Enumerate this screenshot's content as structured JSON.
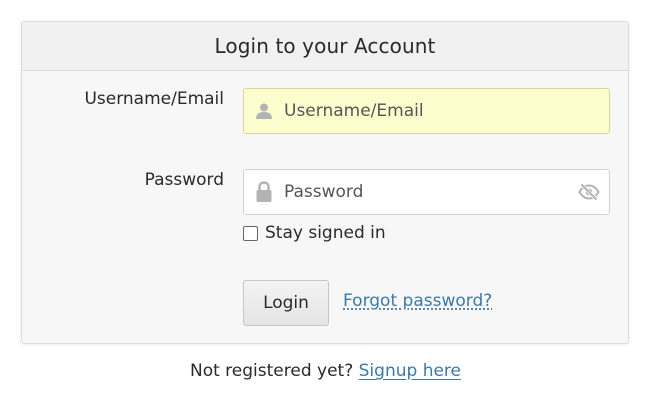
{
  "panel": {
    "title": "Login to your Account"
  },
  "form": {
    "username": {
      "label": "Username/Email",
      "placeholder": "Username/Email",
      "value": "",
      "icon": "user-icon"
    },
    "password": {
      "label": "Password",
      "placeholder": "Password",
      "value": "",
      "icon": "lock-icon",
      "toggle_icon": "eye-slash-icon"
    },
    "remember": {
      "label": "Stay signed in",
      "checked": false
    },
    "login_label": "Login",
    "forgot_label": "Forgot password?"
  },
  "footer": {
    "prompt": "Not registered yet?",
    "signup_label": "Signup here"
  },
  "colors": {
    "link": "#3b7aa8",
    "autofill_bg": "#fefdcd",
    "panel_bg": "#f7f7f7"
  }
}
